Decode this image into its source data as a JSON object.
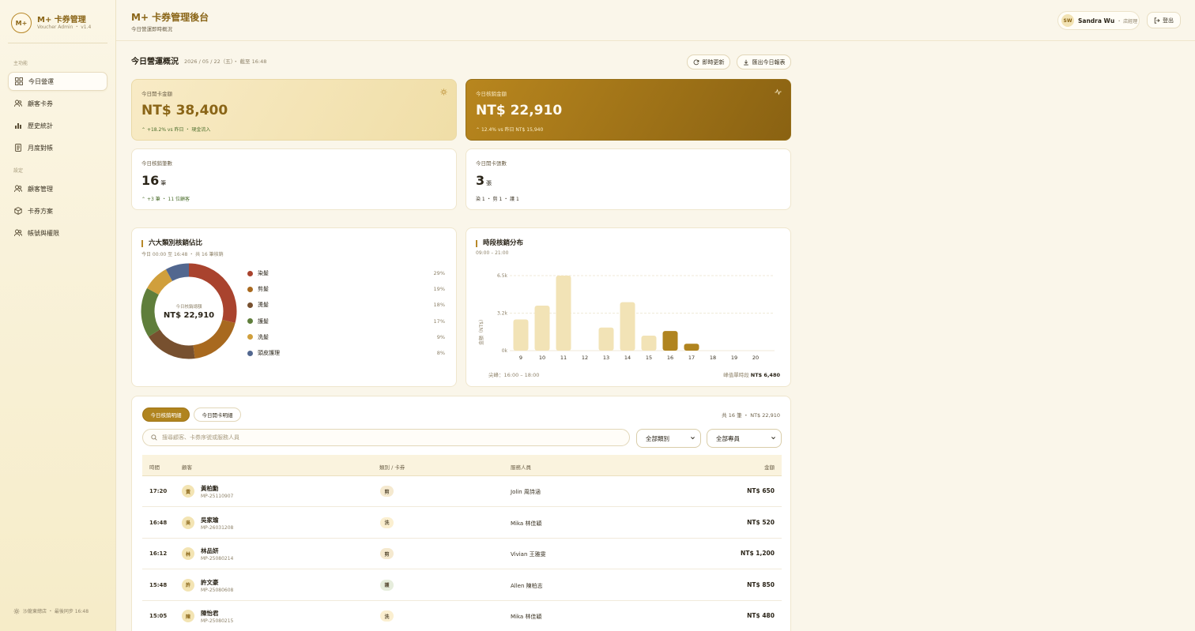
{
  "brand": {
    "logo": "M+",
    "title": "M+ 卡券管理",
    "subtitle": "Voucher Admin ・ v1.4"
  },
  "sidebar": {
    "section_main": "主功能",
    "section_settings": "設定",
    "items": [
      {
        "label": "今日營運",
        "icon": "dashboard-icon"
      },
      {
        "label": "顧客卡券",
        "icon": "users-icon"
      },
      {
        "label": "歷史統計",
        "icon": "chart-icon"
      },
      {
        "label": "月度對帳",
        "icon": "document-icon"
      },
      {
        "label": "顧客管理",
        "icon": "users-icon"
      },
      {
        "label": "卡券方案",
        "icon": "package-icon"
      },
      {
        "label": "帳號與權限",
        "icon": "users-icon"
      }
    ],
    "footer": "沙龍東總店 ・ 最後同步 16:48"
  },
  "header": {
    "title": "M+ 卡券管理後台",
    "subtitle": "今日營運即時概況"
  },
  "user": {
    "initials": "SW",
    "name": "Sandra Wu",
    "role": "・ 店經理",
    "logout": "登出"
  },
  "overview": {
    "title": "今日營運概況",
    "date": "2026 / 05 / 22（五）・ 截至 16:48",
    "refresh": "即時更新",
    "export": "匯出今日報表"
  },
  "kpi": {
    "open_amount": {
      "label": "今日開卡金額",
      "value": "NT$ 38,400",
      "foot": "+18.2% vs 昨日 ・ 現金流入"
    },
    "redeem_amount": {
      "label": "今日核銷金額",
      "value": "NT$ 22,910",
      "foot": "12.4% vs 昨日 NT$ 15,940"
    },
    "redeem_count": {
      "label": "今日核銷筆數",
      "value": "16",
      "unit": "筆",
      "foot": "+3 筆 ・ 11 位顧客"
    },
    "open_count": {
      "label": "今日開卡張數",
      "value": "3",
      "unit": "張",
      "foot": "染 1 ・ 剪 1 ・ 護 1"
    }
  },
  "category_panel": {
    "title": "六大類別核銷佔比",
    "subtitle": "今日 00:00 至 16:48 ・ 共 16 筆核銷",
    "center_label": "今日核銷總額",
    "center_value": "NT$ 22,910"
  },
  "hourly_panel": {
    "title": "時段核銷分布",
    "subtitle": "09:00 – 21:00",
    "peak_label": "尖峰：16:00 – 18:00",
    "max_label": "峰值單時段",
    "max_value": "NT$ 6,480"
  },
  "chart_data": [
    {
      "type": "pie",
      "categories": [
        "染髮",
        "剪髮",
        "燙髮",
        "護髮",
        "洗髮",
        "頭皮護理"
      ],
      "values": [
        29,
        19,
        18,
        17,
        9,
        8
      ],
      "labels": [
        "29%",
        "19%",
        "18%",
        "17%",
        "9%",
        "8%"
      ],
      "colors": [
        "#a9432e",
        "#a8691f",
        "#77502f",
        "#5f7e3b",
        "#d09f3c",
        "#52678f"
      ]
    },
    {
      "type": "bar",
      "categories": [
        "9",
        "10",
        "11",
        "12",
        "13",
        "14",
        "15",
        "16",
        "17",
        "18",
        "19",
        "20"
      ],
      "values": [
        2700,
        3900,
        6500,
        0,
        2000,
        4200,
        1300,
        1700,
        600,
        0,
        0,
        0
      ],
      "highlight": [
        "16",
        "17"
      ],
      "ylabel": "金額（NT$）",
      "yticks": [
        "0k",
        "3.2k",
        "6.5k"
      ],
      "ylim": [
        0,
        6500
      ],
      "grid": true
    }
  ],
  "table": {
    "tab_redeem": "今日核銷明細",
    "tab_open": "今日開卡明細",
    "summary": "共 16 筆 ・ NT$ 22,910",
    "search_placeholder": "搜尋顧客、卡券序號或服務人員",
    "filter_category": "全部類別",
    "filter_staff": "全部專員",
    "headers": {
      "time": "時間",
      "customer": "顧客",
      "category": "類別 / 卡券",
      "staff": "服務人員",
      "amount": "金額"
    },
    "rows": [
      {
        "time": "17:20",
        "avatar": "黃",
        "name": "黃柏勳",
        "id": "MP-25110907",
        "badge": "剪",
        "staff": "Jolin 周詩涵",
        "amount": "NT$ 650"
      },
      {
        "time": "16:48",
        "avatar": "吳",
        "name": "吳家瑜",
        "id": "MP-26031208",
        "badge": "洗",
        "staff": "Mika 林佳穎",
        "amount": "NT$ 520"
      },
      {
        "time": "16:12",
        "avatar": "林",
        "name": "林品妍",
        "id": "MP-25080214",
        "badge": "剪",
        "staff": "Vivian 王雅雯",
        "amount": "NT$ 1,200"
      },
      {
        "time": "15:48",
        "avatar": "許",
        "name": "許文豪",
        "id": "MP-25080608",
        "badge": "護",
        "staff": "Allen 陳柏志",
        "amount": "NT$ 850"
      },
      {
        "time": "15:05",
        "avatar": "陳",
        "name": "陳怡君",
        "id": "MP-25080215",
        "badge": "洗",
        "staff": "Mika 林佳穎",
        "amount": "NT$ 480"
      }
    ]
  }
}
